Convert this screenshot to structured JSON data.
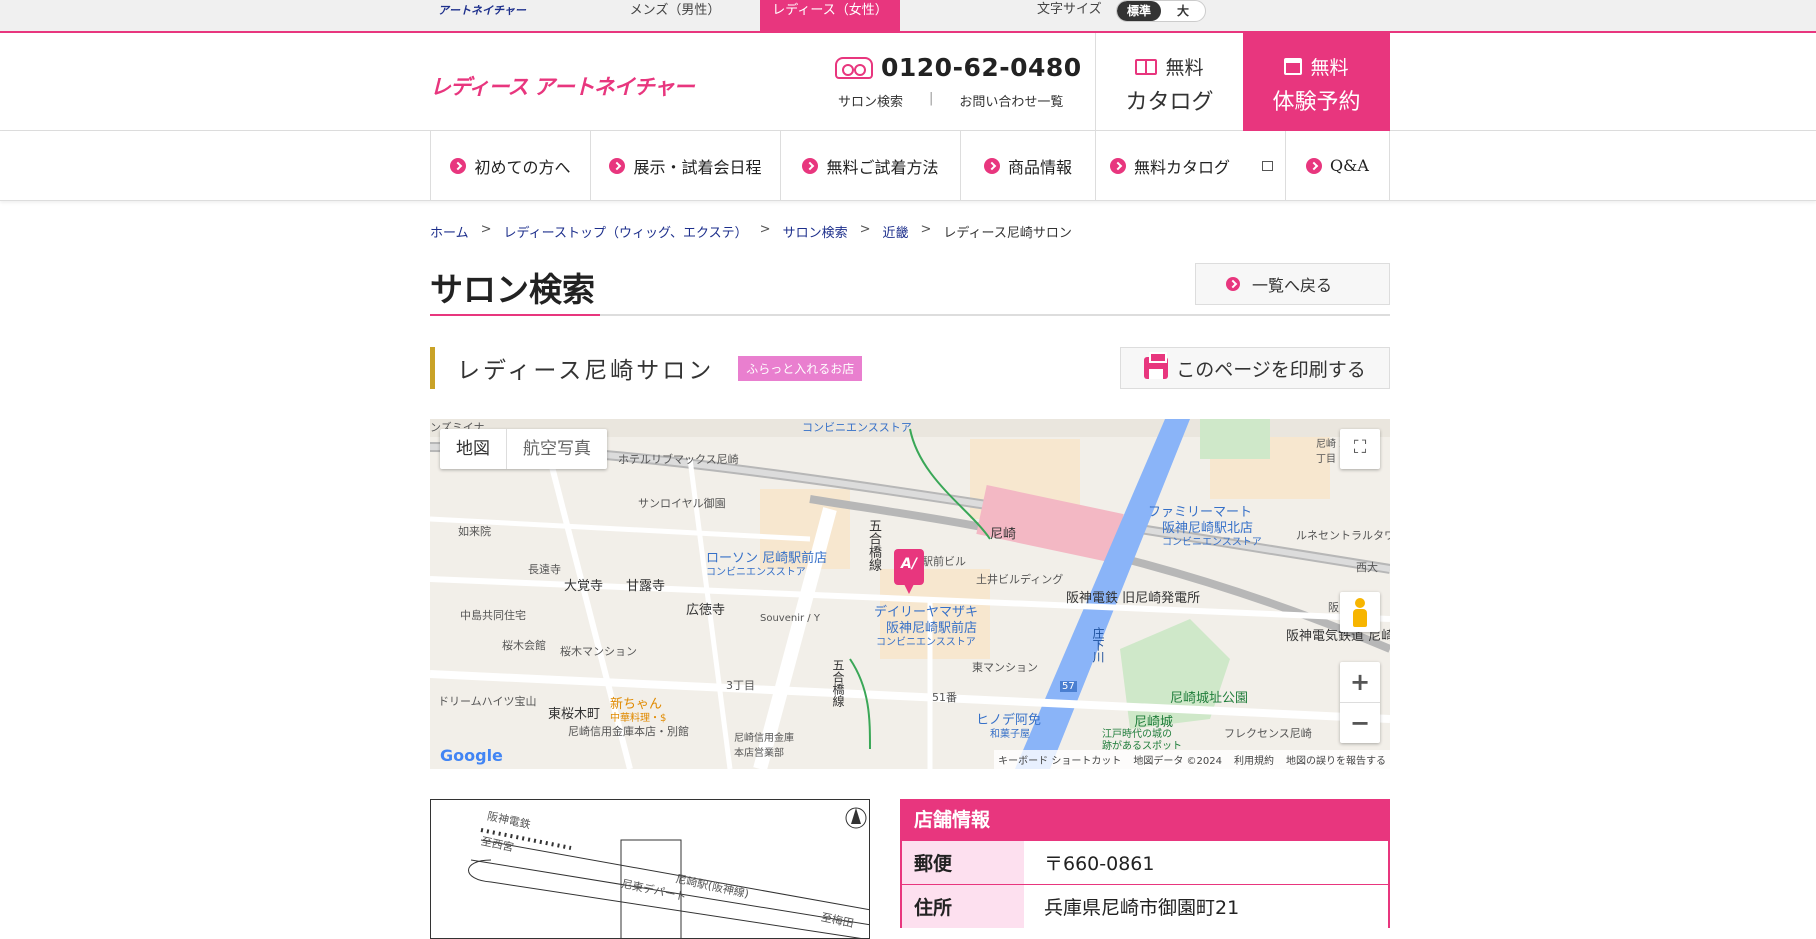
{
  "topbar": {
    "brand": "アートネイチャー",
    "mens_tab": "メンズ（男性）",
    "ladies_tab": "レディース（女性）",
    "font_size_label": "文字サイズ",
    "font_standard": "標準",
    "font_large": "大"
  },
  "header": {
    "logo": "レディース アートネイチャー",
    "phone": "0120-62-0480",
    "link_salon_search": "サロン検索",
    "link_separator": "|",
    "link_contacts": "お問い合わせ一覧",
    "catalog_line1": "無料",
    "catalog_line2": "カタログ",
    "reserve_line1": "無料",
    "reserve_line2": "体験予約"
  },
  "nav": {
    "items": [
      {
        "label": "初めての方へ"
      },
      {
        "label": "展示・試着会日程"
      },
      {
        "label": "無料ご試着方法"
      },
      {
        "label": "商品情報"
      },
      {
        "label": "無料カタログ"
      },
      {
        "label": "Q&A"
      }
    ]
  },
  "breadcrumb": {
    "items": [
      "ホーム",
      "レディーストップ（ウィッグ、エクステ）",
      "サロン検索",
      "近畿"
    ],
    "current": "レディース尼崎サロン",
    "separator": ">"
  },
  "page": {
    "title": "サロン検索",
    "back_button": "一覧へ戻る",
    "salon_name": "レディース尼崎サロン",
    "salon_badge": "ふらっと入れるお店",
    "print_button": "このページを印刷する"
  },
  "map": {
    "type_map": "地図",
    "type_satellite": "航空写真",
    "zoom_in": "+",
    "zoom_out": "−",
    "google": "Google",
    "footer": [
      "キーボード ショートカット",
      "地図データ ©2024",
      "利用規約",
      "地図の誤りを報告する"
    ],
    "pin_label": "A/",
    "labels": {
      "l1": "ンズミイナ",
      "l2": "コンビニエンスストア",
      "l3": "ホテルリブマックス尼崎",
      "l4": "サンロイヤル御園",
      "l5": "如来院",
      "l6": "長遠寺",
      "l7": "大覚寺",
      "l8": "甘露寺",
      "l9": "広徳寺",
      "l10": "中島共同住宅",
      "l11": "桜木会館",
      "l12": "桜木マンション",
      "l13": "ドリームハイツ宝山",
      "l14": "東桜木町",
      "l15": "新ちゃん",
      "l16": "中華料理・$",
      "l17": "尼崎信用金庫本店・別館",
      "l18": "3丁目",
      "l19": "尼崎信用金庫 本店営業部",
      "l20": "ローソン 尼崎駅前店",
      "l21": "コンビニエンスストア",
      "l22": "五合橋線",
      "l23": "駅前ビル",
      "l24": "デイリーヤマザキ",
      "l25": "阪神尼崎駅前店",
      "l26": "コンビニエンスストア",
      "l27": "Souvenir / Y",
      "l28": "土井ビルディング",
      "l29": "尼崎",
      "l30": "ファミリーマート",
      "l31": "阪神尼崎駅北店",
      "l32": "コンビニエンスストア",
      "l33": "ルネセントラルタワ",
      "l34": "尼崎 2丁目",
      "l35": "西大",
      "l36": "阪神電鉄 旧尼崎発電所",
      "l37": "阪神電気鉄道 尼崎",
      "l38": "東マンション",
      "l39": "51番",
      "l40": "ヒノデ阿免",
      "l41": "和菓子屋",
      "l42": "尼崎城址公園",
      "l43": "尼崎城",
      "l44": "江戸時代の城の",
      "l45": "跡があるスポット",
      "l46": "フレクセンス尼崎",
      "l47": "庄下川",
      "l48": "57",
      "l49": "五合橋線",
      "l50": "阪"
    }
  },
  "access_map": {
    "labels": [
      "阪神電鉄",
      "至西宮",
      "尼崎駅(阪神線)",
      "尼東デパート",
      "至梅田"
    ]
  },
  "info": {
    "title": "店舗情報",
    "rows": [
      {
        "key": "郵便",
        "value": "〒660-0861"
      },
      {
        "key": "住所",
        "value": "兵庫県尼崎市御園町21"
      }
    ]
  }
}
